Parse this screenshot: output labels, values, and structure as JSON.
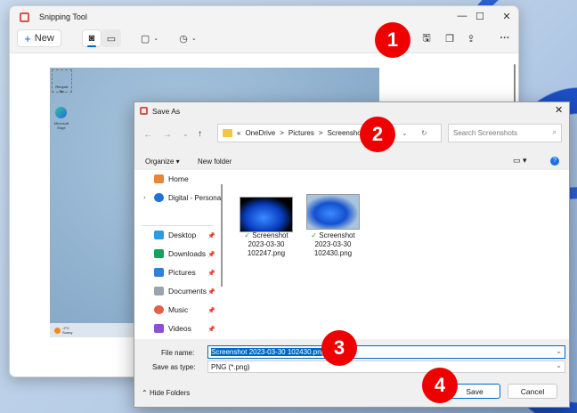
{
  "snipping_tool": {
    "title": "Snipping Tool",
    "new_label": "New",
    "more_label": "···"
  },
  "capture": {
    "recycle_label": "Recycle Bin",
    "edge_label": "Microsoft Edge",
    "weather": "-2°C Sunny"
  },
  "dialog": {
    "title": "Save As",
    "breadcrumb": [
      "«",
      "OneDrive",
      ">",
      "Pictures",
      ">",
      "Screenshots"
    ],
    "search_placeholder": "Search Screenshots",
    "organize_label": "Organize ▾",
    "new_folder_label": "New folder",
    "nav": [
      {
        "label": "Home",
        "color": "#e8863a"
      },
      {
        "label": "Digital - Persona",
        "color": "#1e73d6"
      },
      {
        "label": "Desktop",
        "color": "#2d9be0"
      },
      {
        "label": "Downloads",
        "color": "#17a05e"
      },
      {
        "label": "Pictures",
        "color": "#2f7fe0"
      },
      {
        "label": "Documents",
        "color": "#9aa3b0"
      },
      {
        "label": "Music",
        "color": "#e0604a"
      },
      {
        "label": "Videos",
        "color": "#8c4fd8"
      }
    ],
    "files": [
      {
        "name": "Screenshot",
        "line2": "2023-03-30",
        "line3": "102247.png"
      },
      {
        "name": "Screenshot",
        "line2": "2023-03-30",
        "line3": "102430.png"
      }
    ],
    "file_name_label": "File name:",
    "file_name_value": "Screenshot 2023-03-30 102430.png",
    "save_type_label": "Save as type:",
    "save_type_value": "PNG (*.png)",
    "hide_folders_label": "Hide Folders",
    "save_label": "Save",
    "cancel_label": "Cancel"
  },
  "badges": [
    "1",
    "2",
    "3",
    "4"
  ],
  "colors": {
    "accent": "#0067c0",
    "badge": "#e00000"
  }
}
